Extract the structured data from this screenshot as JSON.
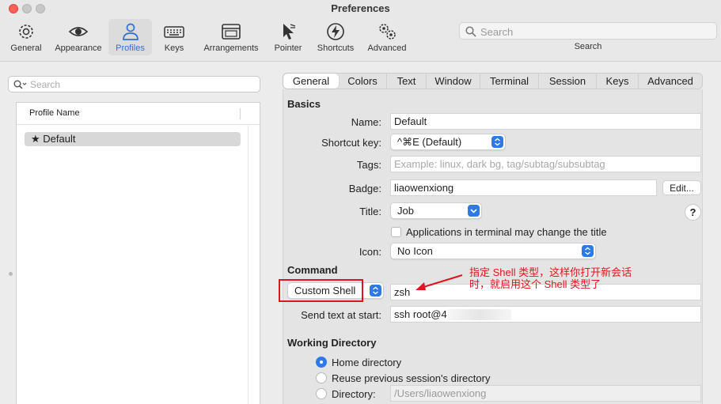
{
  "window": {
    "title": "Preferences"
  },
  "toolbar": {
    "items": [
      {
        "label": "General",
        "icon": "gear-icon"
      },
      {
        "label": "Appearance",
        "icon": "eye-icon"
      },
      {
        "label": "Profiles",
        "icon": "person-icon"
      },
      {
        "label": "Keys",
        "icon": "keyboard-icon"
      },
      {
        "label": "Arrangements",
        "icon": "window-icon"
      },
      {
        "label": "Pointer",
        "icon": "cursor-icon"
      },
      {
        "label": "Shortcuts",
        "icon": "bolt-icon"
      },
      {
        "label": "Advanced",
        "icon": "gears-icon"
      }
    ],
    "active": "Profiles",
    "search": {
      "placeholder": "Search",
      "caption": "Search"
    }
  },
  "sidebar": {
    "search_placeholder": "Search",
    "column_header": "Profile Name",
    "profiles": [
      {
        "name": "★ Default"
      }
    ]
  },
  "tabs": [
    "General",
    "Colors",
    "Text",
    "Window",
    "Terminal",
    "Session",
    "Keys",
    "Advanced"
  ],
  "active_tab": "General",
  "basics": {
    "heading": "Basics",
    "name_label": "Name:",
    "name_value": "Default",
    "shortcut_label": "Shortcut key:",
    "shortcut_value": "^⌘E (Default)",
    "tags_label": "Tags:",
    "tags_placeholder": "Example: linux, dark bg, tag/subtag/subsubtag",
    "badge_label": "Badge:",
    "badge_value": "liaowenxiong",
    "edit_button": "Edit...",
    "title_label": "Title:",
    "title_value": "Job",
    "help_label": "?",
    "apps_change_title": "Applications in terminal may change the title",
    "icon_label": "Icon:",
    "icon_value": "No Icon"
  },
  "command": {
    "heading": "Command",
    "mode": "Custom Shell",
    "value": "zsh",
    "send_text_label": "Send text at start:",
    "send_text_value": "ssh root@4"
  },
  "working_directory": {
    "heading": "Working Directory",
    "options": [
      "Home directory",
      "Reuse previous session's directory",
      "Directory:"
    ],
    "selected": "Home directory",
    "directory_placeholder": "/Users/liaowenxiong"
  },
  "annotation": {
    "line1": "指定 Shell 类型，这样你打开新会话",
    "line2": "时，就启用这个 Shell 类型了",
    "color": "#e0141e"
  },
  "colors": {
    "accent": "#2f78e8",
    "annotation": "#e0141e"
  }
}
